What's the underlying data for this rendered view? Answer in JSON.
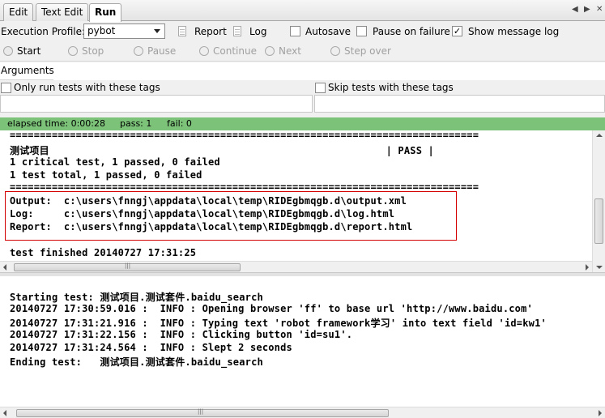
{
  "tabs": [
    {
      "label": "Edit",
      "active": false
    },
    {
      "label": "Text Edit",
      "active": false
    },
    {
      "label": "Run",
      "active": true
    }
  ],
  "profile": {
    "label": "Execution Profile:",
    "value": "pybot",
    "report_label": "Report",
    "log_label": "Log",
    "autosave_label": "Autosave",
    "autosave_checked": false,
    "pause_label": "Pause on failure",
    "pause_checked": false,
    "show_log_label": "Show message log",
    "show_log_checked": true,
    "check_mark": "✓"
  },
  "toolbar": {
    "start": "Start",
    "stop": "Stop",
    "pause": "Pause",
    "continue": "Continue",
    "next": "Next",
    "step_over": "Step over"
  },
  "arguments": {
    "label": "Arguments:",
    "value": ""
  },
  "tags": {
    "only_run_label": "Only run tests with these tags",
    "skip_label": "Skip tests with these tags"
  },
  "status": {
    "elapsed": "elapsed time: 0:00:28",
    "pass": "pass: 1",
    "fail": "fail: 0",
    "color": "#7cc379"
  },
  "output_console": {
    "lines": [
      "==============================================================================",
      "测试项目                                                        | PASS |",
      "1 critical test, 1 passed, 0 failed",
      "1 test total, 1 passed, 0 failed",
      "==============================================================================",
      "Output:  c:\\users\\fnngj\\appdata\\local\\temp\\RIDEgbmqgb.d\\output.xml",
      "Log:     c:\\users\\fnngj\\appdata\\local\\temp\\RIDEgbmqgb.d\\log.html",
      "Report:  c:\\users\\fnngj\\appdata\\local\\temp\\RIDEgbmqgb.d\\report.html",
      "",
      "test finished 20140727 17:31:25"
    ]
  },
  "message_log": {
    "lines": [
      "Starting test: 测试项目.测试套件.baidu_search",
      "20140727 17:30:59.016 :  INFO : Opening browser 'ff' to base url 'http://www.baidu.com'",
      "20140727 17:31:21.916 :  INFO : Typing text 'robot framework学习' into text field 'id=kw1'",
      "20140727 17:31:22.156 :  INFO : Clicking button 'id=su1'.",
      "20140727 17:31:24.564 :  INFO : Slept 2 seconds",
      "Ending test:   测试项目.测试套件.baidu_search"
    ]
  },
  "scroll": {
    "grip": "|||"
  }
}
